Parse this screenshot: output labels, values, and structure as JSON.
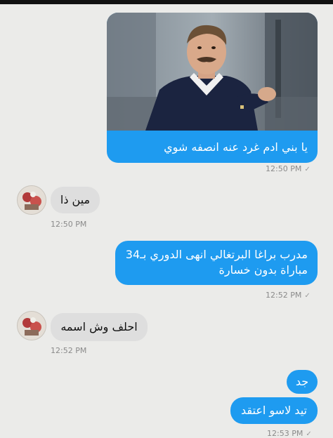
{
  "messages": [
    {
      "id": "m1",
      "direction": "outgoing",
      "has_image": true,
      "image_label": "photo of a smiling man in a dark sweater pointing forward",
      "text": "يا بني ادم غرد عنه انصفه شوي",
      "time": "12:50 PM"
    },
    {
      "id": "m2",
      "direction": "incoming",
      "text": "مين ذا",
      "time": "12:50 PM"
    },
    {
      "id": "m3",
      "direction": "outgoing",
      "line1": "مدرب براغا البرتغالي انهى الدوري بـ34",
      "line2": "مباراة بدون خسارة",
      "time": "12:52 PM"
    },
    {
      "id": "m4",
      "direction": "incoming",
      "text": "احلف وش اسمه",
      "time": "12:52 PM"
    },
    {
      "id": "m5",
      "direction": "outgoing",
      "text": "جد"
    },
    {
      "id": "m6",
      "direction": "outgoing",
      "text": "تيد لاسو اعتقد",
      "time": "12:53 PM"
    }
  ],
  "icons": {
    "read_receipt": "checkmark-icon",
    "avatar": "user-avatar"
  },
  "colors": {
    "outgoing_bubble": "#1e9bf0",
    "incoming_bubble": "#dedede",
    "background": "#ebebe9",
    "timestamp": "#8a8a8a"
  }
}
